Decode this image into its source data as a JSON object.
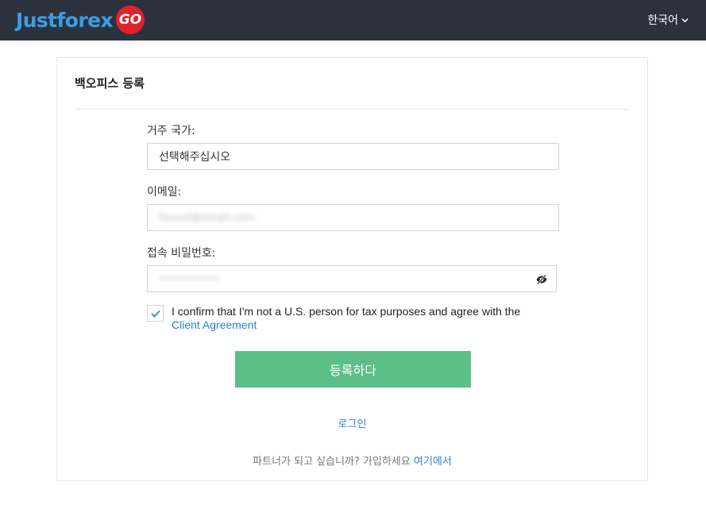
{
  "header": {
    "logo_text": "Justforex",
    "logo_badge": "GO",
    "language": "한국어"
  },
  "form": {
    "title": "백오피스 등록",
    "country_label": "거주 국가:",
    "country_value": "선택해주십시오",
    "email_label": "이메일:",
    "email_value": "hiuuol@email.com",
    "password_label": "접속 비밀번호:",
    "password_value": "••••••••••",
    "confirm_text": "I confirm that I'm not a U.S. person for tax purposes and agree with the",
    "client_agreement_link": "Client Agreement",
    "submit_label": "등록하다",
    "login_link": "로그인",
    "partner_text": "파트너가 되고 싶습니까? 가입하세요",
    "partner_link": "여기에서",
    "checkbox_checked": true
  },
  "colors": {
    "topbar": "#2c323d",
    "brand_blue": "#3b9de4",
    "badge_red": "#e3212b",
    "submit_green": "#5bbf87",
    "link_blue": "#2a7fd4"
  },
  "icons": {
    "language_chevron": "chevron-down-icon",
    "password_toggle": "eye-slash-icon",
    "checkbox_mark": "checkmark-icon"
  }
}
